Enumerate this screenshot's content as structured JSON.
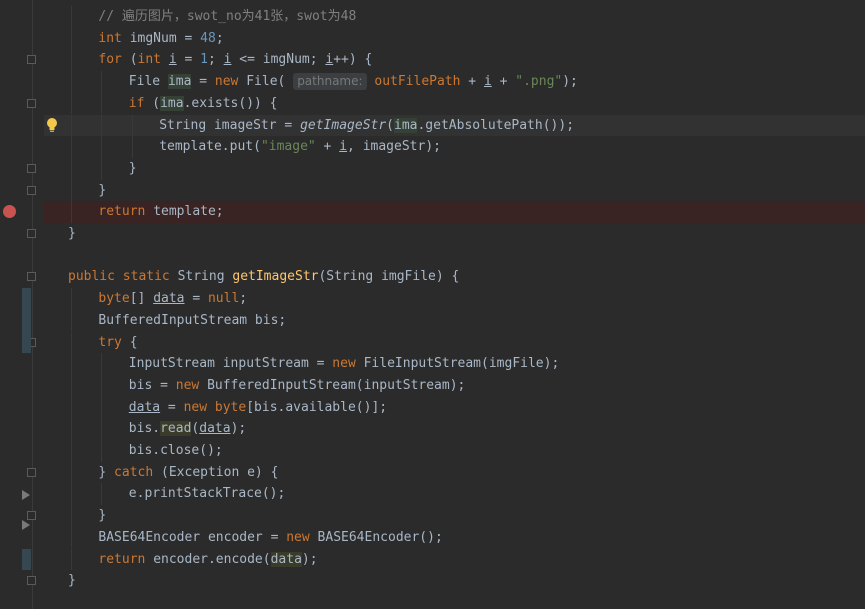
{
  "editor": {
    "lines": [
      {
        "indent": 1,
        "parts": [
          [
            "cmt",
            "// 遍历图片，swot_no为41张，swot为48"
          ]
        ]
      },
      {
        "indent": 1,
        "parts": [
          [
            "kw",
            "int "
          ],
          [
            "",
            "imgNum = "
          ],
          [
            "num",
            "48"
          ],
          [
            "",
            ";"
          ]
        ]
      },
      {
        "indent": 1,
        "parts": [
          [
            "kw",
            "for "
          ],
          [
            "",
            "("
          ],
          [
            "kw",
            "int "
          ],
          [
            "ul",
            "i"
          ],
          [
            "",
            " = "
          ],
          [
            "num",
            "1"
          ],
          [
            "",
            "; "
          ],
          [
            "ul",
            "i"
          ],
          [
            "",
            " <= imgNum; "
          ],
          [
            "ul",
            "i"
          ],
          [
            "",
            "++) {"
          ]
        ]
      },
      {
        "indent": 2,
        "parts": [
          [
            "",
            "File "
          ],
          [
            "hl",
            "ima"
          ],
          [
            "",
            " = "
          ],
          [
            "kw",
            "new "
          ],
          [
            "",
            "File( "
          ],
          [
            "hint",
            "pathname:"
          ],
          [
            "",
            " "
          ],
          [
            "kw",
            "outFilePath"
          ],
          [
            "",
            " + "
          ],
          [
            "ul",
            "i"
          ],
          [
            "",
            " + "
          ],
          [
            "str",
            "\".png\""
          ],
          [
            "",
            ");"
          ]
        ]
      },
      {
        "indent": 2,
        "parts": [
          [
            "kw",
            "if "
          ],
          [
            "",
            "("
          ],
          [
            "hl",
            "ima"
          ],
          [
            "",
            ".exists()) {"
          ]
        ]
      },
      {
        "indent": 3,
        "parts": [
          [
            "",
            "String imageStr = "
          ],
          [
            "fn-it",
            "getImageStr"
          ],
          [
            "",
            "("
          ],
          [
            "hl",
            "ima"
          ],
          [
            "",
            ".getAbsolutePath());"
          ]
        ]
      },
      {
        "indent": 3,
        "parts": [
          [
            "",
            "template.put("
          ],
          [
            "str",
            "\"image\""
          ],
          [
            "",
            " + "
          ],
          [
            "ul",
            "i"
          ],
          [
            "",
            ", imageStr);"
          ]
        ]
      },
      {
        "indent": 2,
        "parts": [
          [
            "",
            "}"
          ]
        ]
      },
      {
        "indent": 1,
        "parts": [
          [
            "",
            "}"
          ]
        ]
      },
      {
        "indent": 1,
        "parts": [
          [
            "kw",
            "return "
          ],
          [
            "",
            "template;"
          ]
        ]
      },
      {
        "indent": 0,
        "parts": [
          [
            "",
            "}"
          ]
        ]
      },
      {
        "indent": 0,
        "parts": []
      },
      {
        "indent": 0,
        "parts": [
          [
            "kw",
            "public static "
          ],
          [
            "",
            "String "
          ],
          [
            "fn",
            "getImageStr"
          ],
          [
            "",
            "(String imgFile) {"
          ]
        ]
      },
      {
        "indent": 1,
        "parts": [
          [
            "kw",
            "byte"
          ],
          [
            "",
            "[] "
          ],
          [
            "ul",
            "data"
          ],
          [
            "",
            " = "
          ],
          [
            "kw",
            "null"
          ],
          [
            "",
            ";"
          ]
        ]
      },
      {
        "indent": 1,
        "parts": [
          [
            "",
            "BufferedInputStream bis;"
          ]
        ]
      },
      {
        "indent": 1,
        "parts": [
          [
            "kw",
            "try "
          ],
          [
            "",
            "{"
          ]
        ]
      },
      {
        "indent": 2,
        "parts": [
          [
            "",
            "InputStream inputStream = "
          ],
          [
            "kw",
            "new "
          ],
          [
            "",
            "FileInputStream(imgFile);"
          ]
        ]
      },
      {
        "indent": 2,
        "parts": [
          [
            "",
            "bis = "
          ],
          [
            "kw",
            "new "
          ],
          [
            "",
            "BufferedInputStream(inputStream);"
          ]
        ]
      },
      {
        "indent": 2,
        "parts": [
          [
            "ul",
            "data"
          ],
          [
            "",
            " = "
          ],
          [
            "kw",
            "new byte"
          ],
          [
            "",
            "[bis.available()];"
          ]
        ]
      },
      {
        "indent": 2,
        "parts": [
          [
            "",
            "bis."
          ],
          [
            "hl2",
            "read"
          ],
          [
            "",
            "("
          ],
          [
            "ul",
            "data"
          ],
          [
            "",
            ");"
          ]
        ]
      },
      {
        "indent": 2,
        "parts": [
          [
            "",
            "bis.close();"
          ]
        ]
      },
      {
        "indent": 1,
        "parts": [
          [
            "",
            "} "
          ],
          [
            "kw",
            "catch "
          ],
          [
            "",
            "(Exception e) {"
          ]
        ]
      },
      {
        "indent": 2,
        "parts": [
          [
            "",
            "e.printStackTrace();"
          ]
        ]
      },
      {
        "indent": 1,
        "parts": [
          [
            "",
            "}"
          ]
        ]
      },
      {
        "indent": 1,
        "parts": [
          [
            "",
            "BASE64Encoder encoder = "
          ],
          [
            "kw",
            "new "
          ],
          [
            "",
            "BASE64Encoder();"
          ]
        ]
      },
      {
        "indent": 1,
        "parts": [
          [
            "kw",
            "return "
          ],
          [
            "",
            "encoder.encode("
          ],
          [
            "hl2",
            "data"
          ],
          [
            "",
            ");"
          ]
        ]
      },
      {
        "indent": 0,
        "parts": [
          [
            "",
            "}"
          ]
        ]
      }
    ]
  },
  "gutter": {
    "breakpoint_icon": "breakpoint-icon",
    "bulb_icon": "lightbulb-icon",
    "fold_icon": "fold-marker-icon",
    "arrow_icon": "collapsed-arrow-icon"
  },
  "colors": {
    "background": "#2b2b2b",
    "keyword": "#cc7832",
    "number": "#6897bb",
    "string": "#6a8759",
    "comment": "#808080",
    "method": "#ffc66d",
    "breakpoint": "#c75450"
  }
}
